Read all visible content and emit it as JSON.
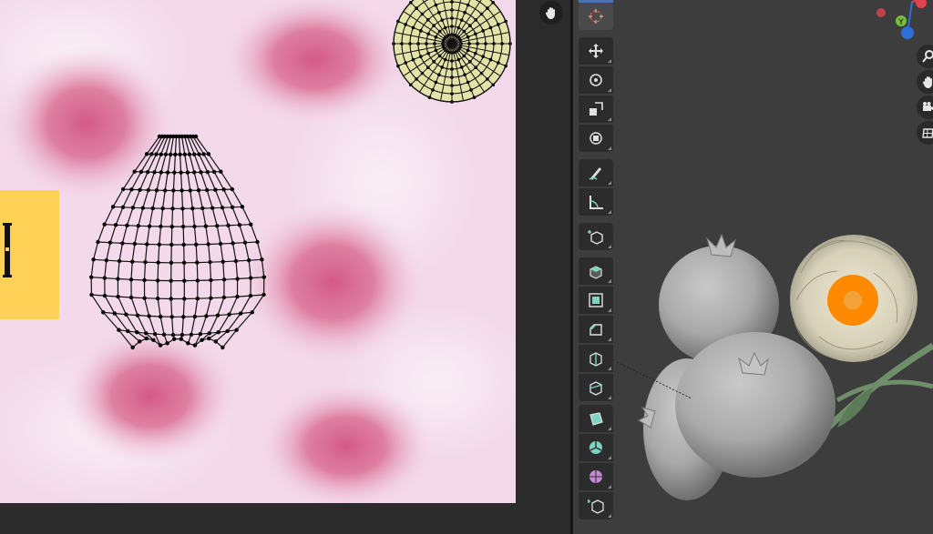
{
  "window": {
    "editors": [
      "uv-editor",
      "3d-viewport"
    ]
  },
  "uv_editor": {
    "background_color": "#f3d9ea",
    "tab_color": "#ffd257",
    "hand_icon": "hand-icon",
    "meshes": [
      "pomegranate-body-uv-island",
      "calyx-uv-island"
    ]
  },
  "viewport": {
    "background_color": "#3d3d3d",
    "gizmo_axis": "Y",
    "toolbar": {
      "tools": [
        {
          "name": "cursor-tool",
          "icon": "cursor-icon",
          "active": true
        },
        {
          "name": "move-tool",
          "icon": "move-icon"
        },
        {
          "name": "rotate-tool",
          "icon": "rotate-icon"
        },
        {
          "name": "scale-tool",
          "icon": "scale-icon"
        },
        {
          "name": "transform-tool",
          "icon": "transform-icon"
        },
        {
          "name": "annotate-tool",
          "icon": "annotate-icon"
        },
        {
          "name": "measure-tool",
          "icon": "measure-icon"
        },
        {
          "name": "add-cube-tool",
          "icon": "add-cube-icon"
        },
        {
          "name": "extrude-tool",
          "icon": "extrude-icon"
        },
        {
          "name": "inset-tool",
          "icon": "inset-icon"
        },
        {
          "name": "bevel-tool",
          "icon": "bevel-icon"
        },
        {
          "name": "loop-cut-tool",
          "icon": "loop-cut-icon"
        },
        {
          "name": "knife-tool",
          "icon": "knife-icon"
        },
        {
          "name": "poly-build-tool",
          "icon": "poly-build-icon"
        },
        {
          "name": "spin-tool",
          "icon": "spin-icon"
        },
        {
          "name": "smooth-tool",
          "icon": "smooth-icon"
        },
        {
          "name": "shear-tool",
          "icon": "shear-icon"
        }
      ]
    },
    "nav_buttons": [
      "zoom-icon",
      "hand-icon",
      "camera-icon",
      "grid-icon"
    ],
    "flower_center_color": "#ff8a00"
  }
}
